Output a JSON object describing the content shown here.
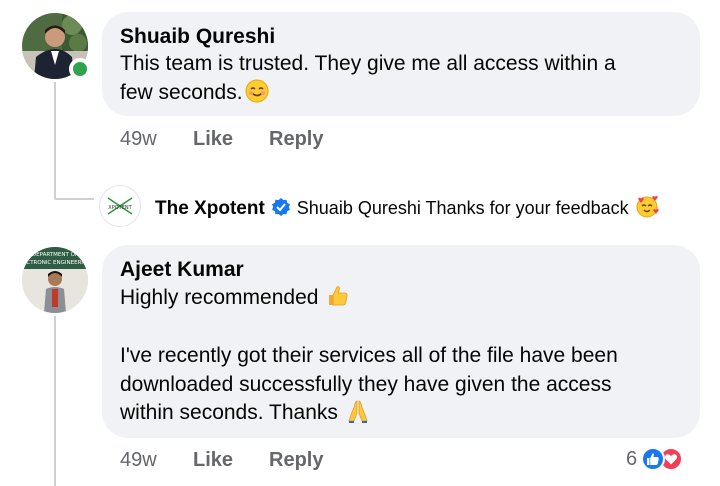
{
  "comments": [
    {
      "author": "Shuaib Qureshi",
      "text_line1": "This team is trusted. They give me all access within a",
      "text_line2": "few seconds.",
      "age": "49w",
      "like_label": "Like",
      "reply_label": "Reply",
      "online": true
    },
    {
      "author": "Ajeet Kumar",
      "text_line1": "Highly recommended",
      "text_line2": "I've recently got their services all of the file have been",
      "text_line3": "downloaded successfully they have given the access",
      "text_line4": "within seconds. Thanks",
      "age": "49w",
      "like_label": "Like",
      "reply_label": "Reply",
      "reaction_count": "6",
      "avatar_sign_line1": "DEPARTMENT OF",
      "avatar_sign_line2": "ECTRONIC ENGINEERIN"
    }
  ],
  "reply": {
    "author": "The Xpotent",
    "mention": "Shuaib Qureshi",
    "text": "Thanks for your feedback",
    "logo_text": "XPOTENT"
  },
  "colors": {
    "bubble": "#f0f2f5",
    "meta": "#65676b",
    "like_blue": "#1877f2",
    "love_red": "#f33e58",
    "online_green": "#31a24c"
  },
  "icons": [
    "online-status-icon",
    "verified-badge-icon",
    "smiling-emoji-icon",
    "love-hearts-emoji-icon",
    "thumbs-up-emoji-icon",
    "folded-hands-emoji-icon",
    "like-reaction-icon",
    "love-reaction-icon"
  ]
}
